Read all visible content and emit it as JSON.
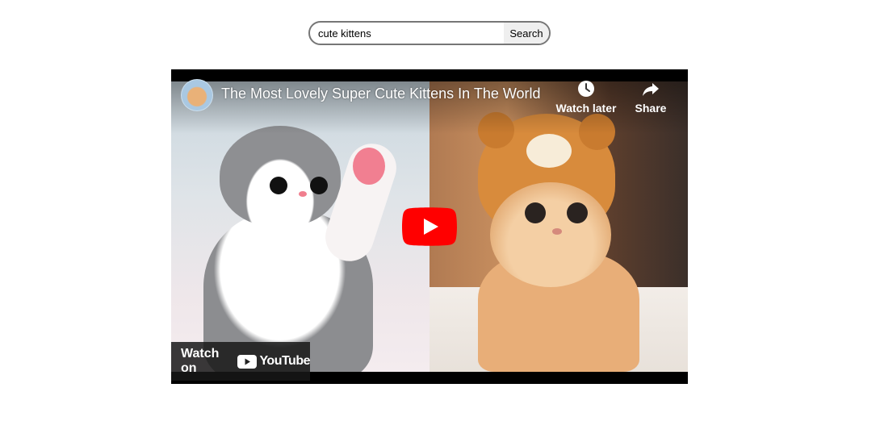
{
  "search": {
    "value": "cute kittens",
    "button_label": "Search"
  },
  "video": {
    "title": "The Most Lovely Super Cute Kittens In The World ...",
    "watch_later_label": "Watch later",
    "share_label": "Share",
    "watch_on_label": "Watch on",
    "youtube_label": "YouTube",
    "play_button_color": "#ff0000"
  }
}
